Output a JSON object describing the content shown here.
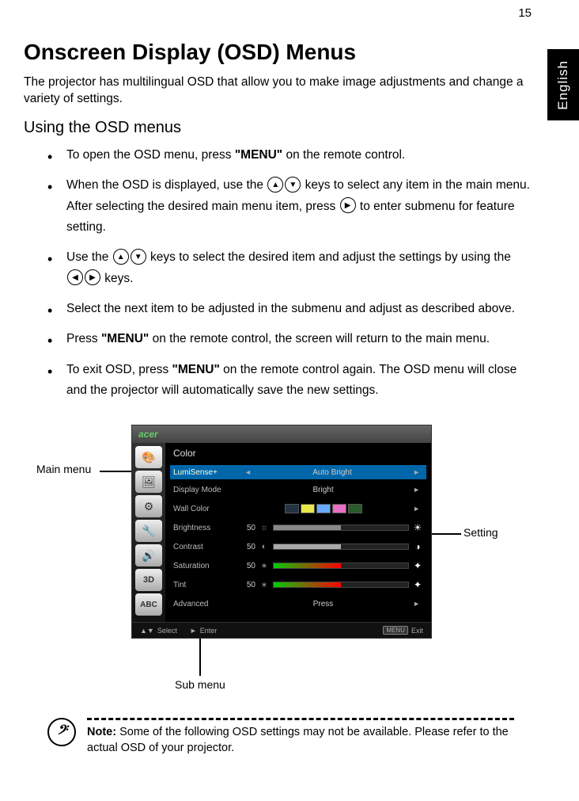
{
  "page_number": "15",
  "language_tab": "English",
  "heading": "Onscreen Display (OSD) Menus",
  "intro": "The projector has multilingual OSD that allow you to make image adjustments and change a variety of settings.",
  "subheading": "Using the OSD menus",
  "menu_word": "\"MENU\"",
  "bullets": {
    "b1a": "To open the OSD menu, press ",
    "b1b": " on the remote control.",
    "b2a": "When the OSD is displayed, use the ",
    "b2b": " keys to select any item in the main menu. After selecting the desired main menu item, press ",
    "b2c": " to enter submenu for feature setting.",
    "b3a": "Use the ",
    "b3b": " keys to select the desired item and adjust the settings by using the ",
    "b3c": " keys.",
    "b4": "Select the next item to be adjusted in the submenu and adjust as described above.",
    "b5a": "Press ",
    "b5b": " on the remote control, the screen will return to the main menu.",
    "b6a": "To exit OSD, press ",
    "b6b": " on the remote control again. The OSD menu will close and the projector will automatically save the new settings."
  },
  "osd": {
    "brand": "acer",
    "panel_title": "Color",
    "rows": {
      "lumisense": {
        "label": "LumiSense+",
        "value": "Auto Bright"
      },
      "display_mode": {
        "label": "Display Mode",
        "value": "Bright"
      },
      "wall_color": {
        "label": "Wall Color"
      },
      "brightness": {
        "label": "Brightness",
        "value": "50",
        "fill": "#888",
        "pct": 50
      },
      "contrast": {
        "label": "Contrast",
        "value": "50",
        "fill": "#aaa",
        "pct": 50
      },
      "saturation": {
        "label": "Saturation",
        "value": "50",
        "fill_gradient": "linear-gradient(90deg,#0c0,#060)",
        "pct": 50
      },
      "tint": {
        "label": "Tint",
        "value": "50",
        "fill_gradient": "linear-gradient(90deg,#0c0,#060)",
        "pct": 50
      },
      "advanced": {
        "label": "Advanced",
        "value": "Press"
      }
    },
    "wall_swatches": [
      "#223344",
      "#e8e84a",
      "#66aaff",
      "#e86fc1",
      "#2a5a2a"
    ],
    "footer": {
      "select": "Select",
      "enter": "Enter",
      "exit": "Exit",
      "menu_key": "MENU"
    }
  },
  "callouts": {
    "main_menu": "Main menu",
    "sub_menu": "Sub menu",
    "setting": "Setting"
  },
  "note": {
    "label": "Note:",
    "text": " Some of the following OSD settings may not be available. Please refer to the actual OSD of your projector."
  }
}
